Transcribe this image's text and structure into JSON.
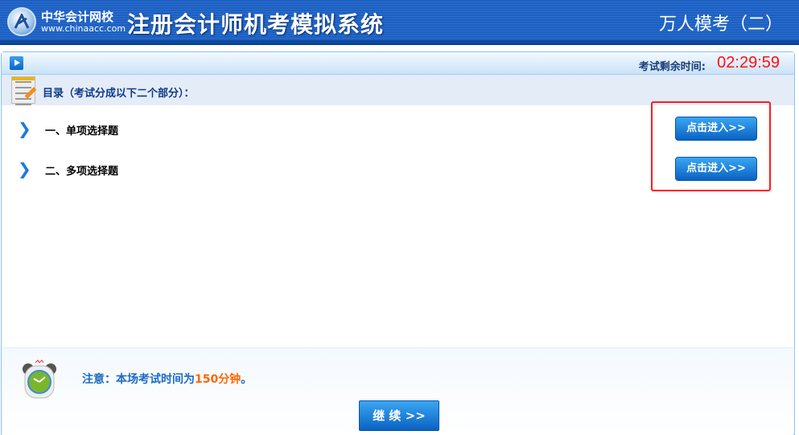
{
  "header": {
    "brand_cn": "中华会计网校",
    "brand_url": "www.chinaacc.com",
    "system_title": "注册会计师机考模拟系统",
    "exam_name": "万人模考（二）"
  },
  "topbar": {
    "time_label": "考试剩余时间:",
    "time_remaining": "02:29:59"
  },
  "toc": {
    "title": "目录（考试分成以下二个部分）："
  },
  "sections": [
    {
      "label": "一、单项选择题",
      "button": "点击进入>>"
    },
    {
      "label": "二、多项选择题",
      "button": "点击进入>>"
    }
  ],
  "footer": {
    "notice_prefix": "注意：本场考试时间为",
    "notice_highlight": "150分钟",
    "notice_suffix": "。",
    "continue_label": "继 续 >>"
  },
  "colors": {
    "accent": "#1d6bc4",
    "timer": "#ff1010",
    "highlight": "#ff6600"
  }
}
